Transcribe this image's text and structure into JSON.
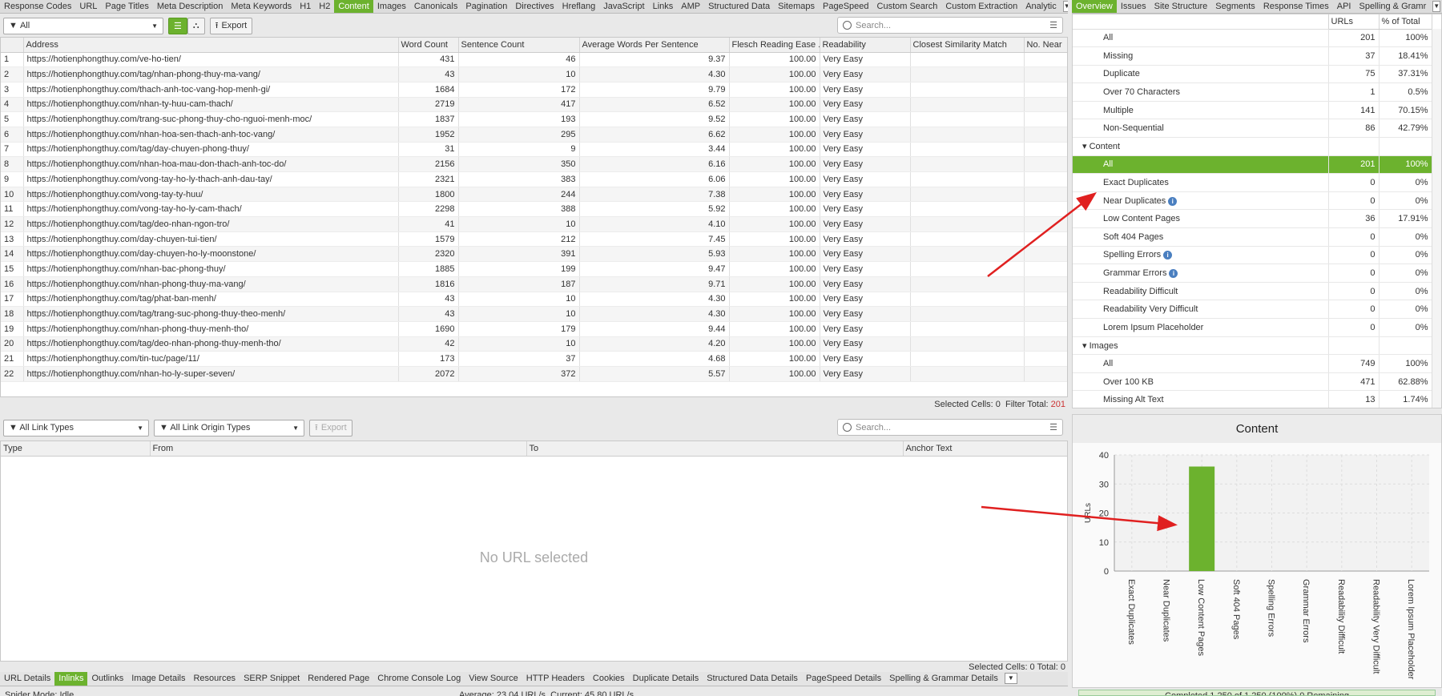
{
  "top_tabs": [
    "Response Codes",
    "URL",
    "Page Titles",
    "Meta Description",
    "Meta Keywords",
    "H1",
    "H2",
    "Content",
    "Images",
    "Canonicals",
    "Pagination",
    "Directives",
    "Hreflang",
    "JavaScript",
    "Links",
    "AMP",
    "Structured Data",
    "Sitemaps",
    "PageSpeed",
    "Custom Search",
    "Custom Extraction",
    "Analytic"
  ],
  "top_active": "Content",
  "toolbar": {
    "filter": "All",
    "export": "Export",
    "search_placeholder": "Search..."
  },
  "columns": [
    "Address",
    "Word Count",
    "Sentence Count",
    "Average Words Per Sentence",
    "Flesch Reading Ease ...",
    "Readability",
    "Closest Similarity Match",
    "No. Near"
  ],
  "rows": [
    [
      "https://hotienphongthuy.com/ve-ho-tien/",
      "431",
      "46",
      "9.37",
      "100.00",
      "Very Easy"
    ],
    [
      "https://hotienphongthuy.com/tag/nhan-phong-thuy-ma-vang/",
      "43",
      "10",
      "4.30",
      "100.00",
      "Very Easy"
    ],
    [
      "https://hotienphongthuy.com/thach-anh-toc-vang-hop-menh-gi/",
      "1684",
      "172",
      "9.79",
      "100.00",
      "Very Easy"
    ],
    [
      "https://hotienphongthuy.com/nhan-ty-huu-cam-thach/",
      "2719",
      "417",
      "6.52",
      "100.00",
      "Very Easy"
    ],
    [
      "https://hotienphongthuy.com/trang-suc-phong-thuy-cho-nguoi-menh-moc/",
      "1837",
      "193",
      "9.52",
      "100.00",
      "Very Easy"
    ],
    [
      "https://hotienphongthuy.com/nhan-hoa-sen-thach-anh-toc-vang/",
      "1952",
      "295",
      "6.62",
      "100.00",
      "Very Easy"
    ],
    [
      "https://hotienphongthuy.com/tag/day-chuyen-phong-thuy/",
      "31",
      "9",
      "3.44",
      "100.00",
      "Very Easy"
    ],
    [
      "https://hotienphongthuy.com/nhan-hoa-mau-don-thach-anh-toc-do/",
      "2156",
      "350",
      "6.16",
      "100.00",
      "Very Easy"
    ],
    [
      "https://hotienphongthuy.com/vong-tay-ho-ly-thach-anh-dau-tay/",
      "2321",
      "383",
      "6.06",
      "100.00",
      "Very Easy"
    ],
    [
      "https://hotienphongthuy.com/vong-tay-ty-huu/",
      "1800",
      "244",
      "7.38",
      "100.00",
      "Very Easy"
    ],
    [
      "https://hotienphongthuy.com/vong-tay-ho-ly-cam-thach/",
      "2298",
      "388",
      "5.92",
      "100.00",
      "Very Easy"
    ],
    [
      "https://hotienphongthuy.com/tag/deo-nhan-ngon-tro/",
      "41",
      "10",
      "4.10",
      "100.00",
      "Very Easy"
    ],
    [
      "https://hotienphongthuy.com/day-chuyen-tui-tien/",
      "1579",
      "212",
      "7.45",
      "100.00",
      "Very Easy"
    ],
    [
      "https://hotienphongthuy.com/day-chuyen-ho-ly-moonstone/",
      "2320",
      "391",
      "5.93",
      "100.00",
      "Very Easy"
    ],
    [
      "https://hotienphongthuy.com/nhan-bac-phong-thuy/",
      "1885",
      "199",
      "9.47",
      "100.00",
      "Very Easy"
    ],
    [
      "https://hotienphongthuy.com/nhan-phong-thuy-ma-vang/",
      "1816",
      "187",
      "9.71",
      "100.00",
      "Very Easy"
    ],
    [
      "https://hotienphongthuy.com/tag/phat-ban-menh/",
      "43",
      "10",
      "4.30",
      "100.00",
      "Very Easy"
    ],
    [
      "https://hotienphongthuy.com/tag/trang-suc-phong-thuy-theo-menh/",
      "43",
      "10",
      "4.30",
      "100.00",
      "Very Easy"
    ],
    [
      "https://hotienphongthuy.com/nhan-phong-thuy-menh-tho/",
      "1690",
      "179",
      "9.44",
      "100.00",
      "Very Easy"
    ],
    [
      "https://hotienphongthuy.com/tag/deo-nhan-phong-thuy-menh-tho/",
      "42",
      "10",
      "4.20",
      "100.00",
      "Very Easy"
    ],
    [
      "https://hotienphongthuy.com/tin-tuc/page/11/",
      "173",
      "37",
      "4.68",
      "100.00",
      "Very Easy"
    ],
    [
      "https://hotienphongthuy.com/nhan-ho-ly-super-seven/",
      "2072",
      "372",
      "5.57",
      "100.00",
      "Very Easy"
    ]
  ],
  "status_top": {
    "selected_label": "Selected Cells:",
    "selected": "0",
    "filter_label": "Filter Total:",
    "filter": "201"
  },
  "lower": {
    "link_types": "All Link Types",
    "origin_types": "All Link Origin Types",
    "export": "Export",
    "search_placeholder": "Search...",
    "columns": [
      "Type",
      "From",
      "To",
      "Anchor Text"
    ],
    "empty": "No URL selected",
    "status": "Selected Cells: 0  Total: 0"
  },
  "bottom_tabs": [
    "URL Details",
    "Inlinks",
    "Outlinks",
    "Image Details",
    "Resources",
    "SERP Snippet",
    "Rendered Page",
    "Chrome Console Log",
    "View Source",
    "HTTP Headers",
    "Cookies",
    "Duplicate Details",
    "Structured Data Details",
    "PageSpeed Details",
    "Spelling & Grammar Details"
  ],
  "bottom_active": "Inlinks",
  "right_tabs": [
    "Overview",
    "Issues",
    "Site Structure",
    "Segments",
    "Response Times",
    "API",
    "Spelling & Gramr"
  ],
  "right_active": "Overview",
  "right_columns": [
    "URLs",
    "% of Total"
  ],
  "right_rows": [
    {
      "label": "All",
      "urls": "201",
      "pct": "100%"
    },
    {
      "label": "Missing",
      "urls": "37",
      "pct": "18.41%"
    },
    {
      "label": "Duplicate",
      "urls": "75",
      "pct": "37.31%"
    },
    {
      "label": "Over 70 Characters",
      "urls": "1",
      "pct": "0.5%"
    },
    {
      "label": "Multiple",
      "urls": "141",
      "pct": "70.15%"
    },
    {
      "label": "Non-Sequential",
      "urls": "86",
      "pct": "42.79%"
    },
    {
      "section": "Content"
    },
    {
      "label": "All",
      "urls": "201",
      "pct": "100%",
      "selected": true
    },
    {
      "label": "Exact Duplicates",
      "urls": "0",
      "pct": "0%"
    },
    {
      "label": "Near Duplicates",
      "urls": "0",
      "pct": "0%",
      "info": true
    },
    {
      "label": "Low Content Pages",
      "urls": "36",
      "pct": "17.91%"
    },
    {
      "label": "Soft 404 Pages",
      "urls": "0",
      "pct": "0%"
    },
    {
      "label": "Spelling Errors",
      "urls": "0",
      "pct": "0%",
      "info": true
    },
    {
      "label": "Grammar Errors",
      "urls": "0",
      "pct": "0%",
      "info": true
    },
    {
      "label": "Readability Difficult",
      "urls": "0",
      "pct": "0%"
    },
    {
      "label": "Readability Very Difficult",
      "urls": "0",
      "pct": "0%"
    },
    {
      "label": "Lorem Ipsum Placeholder",
      "urls": "0",
      "pct": "0%"
    },
    {
      "section": "Images"
    },
    {
      "label": "All",
      "urls": "749",
      "pct": "100%"
    },
    {
      "label": "Over 100 KB",
      "urls": "471",
      "pct": "62.88%"
    },
    {
      "label": "Missing Alt Text",
      "urls": "13",
      "pct": "1.74%"
    }
  ],
  "chart_data": {
    "type": "bar",
    "title": "Content",
    "ylabel": "URLs",
    "ylim": [
      0,
      40
    ],
    "yticks": [
      0,
      10,
      20,
      30,
      40
    ],
    "grid": true,
    "categories": [
      "Exact Duplicates",
      "Near Duplicates",
      "Low Content Pages",
      "Soft 404 Pages",
      "Spelling Errors",
      "Grammar Errors",
      "Readability Difficult",
      "Readability Very Difficult",
      "Lorem Ipsum Placeholder"
    ],
    "values": [
      0,
      0,
      36,
      0,
      0,
      0,
      0,
      0,
      0
    ],
    "color": "#6cb22e"
  },
  "statusbar": {
    "mode": "Spider Mode: Idle",
    "speed": "Average: 23.04 URL/s. Current: 45.80 URL/s",
    "progress": "Completed 1,250 of 1,250 (100%) 0 Remaining"
  },
  "colors": {
    "accent": "#6cb22e",
    "annotation_arrow": "#e02020"
  }
}
